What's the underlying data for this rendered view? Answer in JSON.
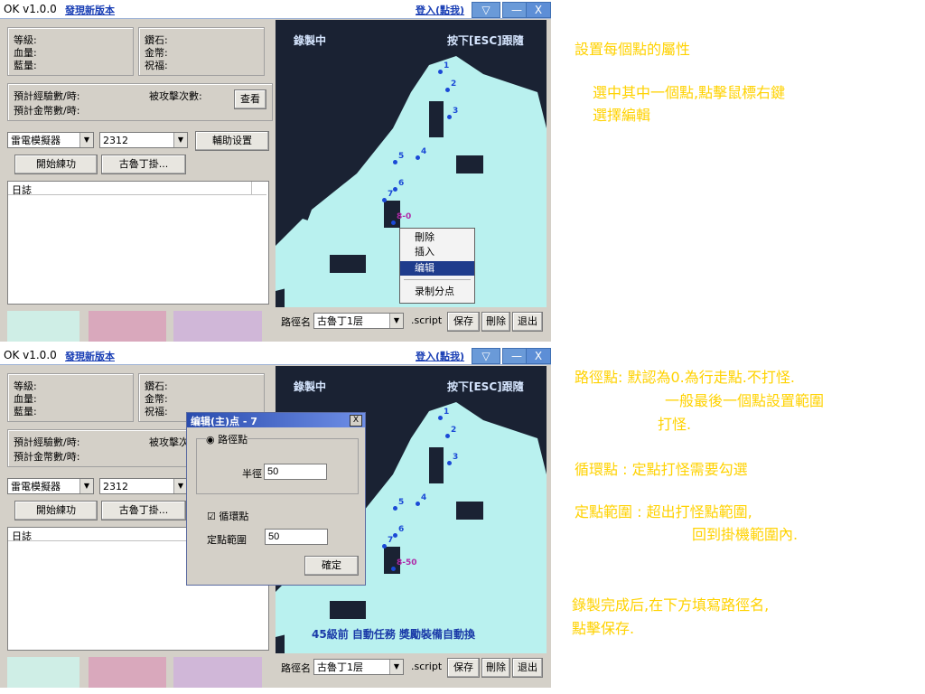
{
  "app": {
    "title": "OK v1.0.0",
    "update_link": "發現新版本",
    "login_link": "登入(點我)",
    "arrow_icon": "▽",
    "minimize_icon": "—",
    "close_icon": "X"
  },
  "stats": {
    "level": "等級:",
    "hp": "血量:",
    "mp": "藍量:",
    "diamond": "鑽石:",
    "gold": "金幣:",
    "blessing": "祝福:"
  },
  "exp": {
    "exp_per_hour": "預計經驗數/時:",
    "gold_per_hour": "預計金幣數/時:",
    "attacked": "被攻擊次數:",
    "attacked_short": "被攻擊次",
    "view_btn": "查看"
  },
  "controls": {
    "emulator": "雷電模擬器",
    "port": "2312",
    "assist_btn": "輔助设置",
    "start_btn": "開始練功",
    "gludin_btn": "古魯丁掛..."
  },
  "log": {
    "title": "日誌"
  },
  "map": {
    "recording": "錄製中",
    "esc_hint": "按下[ESC]跟隨",
    "banner": "45級前 自動任務  獎勵裝備自動換",
    "points_top": [
      "1",
      "2",
      "3",
      "4",
      "5",
      "6",
      "7",
      "8-0"
    ],
    "points_bottom": [
      "1",
      "2",
      "3",
      "4",
      "5",
      "6",
      "7",
      "8-50"
    ]
  },
  "context_menu": [
    "刪除",
    "插入",
    "编辑",
    "录制分点"
  ],
  "path": {
    "label": "路徑名",
    "value": "古魯丁1层",
    "ext": ".script",
    "save": "保存",
    "delete": "刪除",
    "exit": "退出"
  },
  "dialog": {
    "title": "编辑(主)点 - 7",
    "close": "X",
    "radio_label": "路徑點",
    "radius_label": "半徑",
    "radius_value": "50",
    "loop_label": "循環點",
    "range_label": "定點範圍",
    "range_value": "50",
    "ok": "確定"
  },
  "annotations": {
    "top_line1": "設置每個點的屬性",
    "top_line2": "選中其中一個點,點擊鼠標右鍵",
    "top_line3": "選擇編輯",
    "b1_line1": "路徑點: 默認為0.為行走點.不打怪.",
    "b1_line2": "一般最後一個點設置範圍",
    "b1_line3": "打怪.",
    "b2": "循環點 : 定點打怪需要勾選",
    "b3_line1": "定點範圍 : 超出打怪點範圍,",
    "b3_line2": "回到掛機範圍內.",
    "b4_line1": "錄製完成后,在下方填寫路徑名,",
    "b4_line2": "點擊保存."
  },
  "colors": {
    "map_bg": "#1a2233",
    "map_floor": "#b9f1ef",
    "point": "#1a49d6",
    "note": "#ffd200",
    "menu_highlight": "#1f3c8c"
  }
}
